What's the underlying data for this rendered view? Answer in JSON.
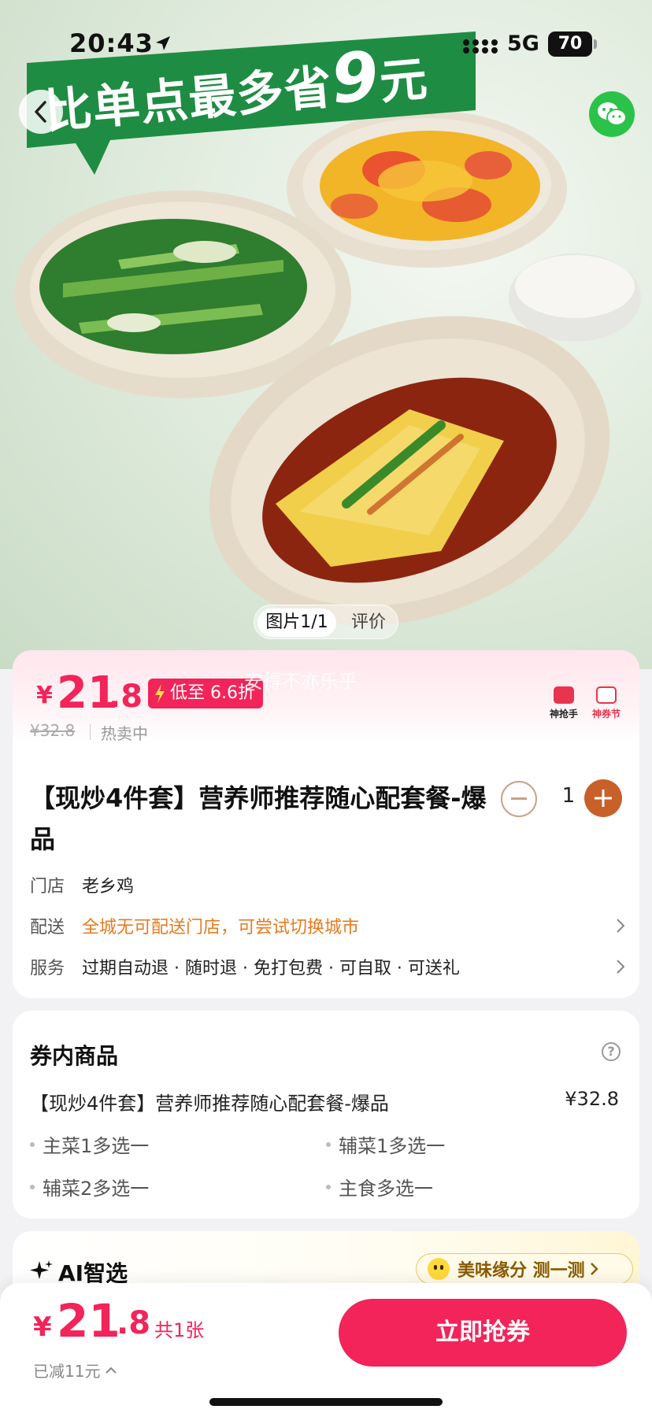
{
  "status_bar": {
    "time": "20:43",
    "network": "5G",
    "battery": "70"
  },
  "hero": {
    "promo_prefix": "比单点最多省",
    "promo_amount": "9",
    "promo_suffix": "元",
    "pager_active": "图片1/1",
    "pager_other": "评价",
    "icons": {
      "back": "chevron-left-icon",
      "share": "wechat-icon"
    }
  },
  "price": {
    "yen": "¥",
    "int": "21",
    "dec": ".8",
    "discount_badge": "低至 6.6折",
    "watermark": "安得不亦乐乎",
    "original": "¥32.8",
    "hot": "热卖中",
    "badges": [
      "神抢手",
      "神券节"
    ],
    "colors": {
      "accent": "#f2245a"
    }
  },
  "product": {
    "title": "【现炒4件套】营养师推荐随心配套餐-爆品",
    "quantity": "1",
    "rows": [
      {
        "label": "门店",
        "value": "老乡鸡",
        "has_arrow": false
      },
      {
        "label": "配送",
        "value": "全城无可配送门店，可尝试切换城市",
        "has_arrow": true
      },
      {
        "label": "服务",
        "value": "过期自动退 · 随时退 · 免打包费 · 可自取 · 可送礼",
        "has_arrow": true
      }
    ]
  },
  "voucher": {
    "title": "券内商品",
    "item_name": "【现炒4件套】营养师推荐随心配套餐-爆品",
    "item_price": "¥32.8",
    "options": [
      "主菜1多选一",
      "辅菜1多选一",
      "辅菜2多选一",
      "主食多选一"
    ]
  },
  "ai": {
    "title": "AI智选",
    "pill": "美味缘分 测一测"
  },
  "bottom": {
    "yen": "¥",
    "int": "21",
    "dec": ".8",
    "count": "共1张",
    "reduced": "已减11元",
    "cta": "立即抢券"
  }
}
